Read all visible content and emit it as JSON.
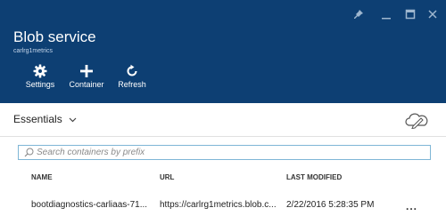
{
  "blade": {
    "title": "Blob service",
    "subtitle": "carlrg1metrics"
  },
  "commands": [
    {
      "label": "Settings",
      "icon": "gear-icon"
    },
    {
      "label": "Container",
      "icon": "plus-icon"
    },
    {
      "label": "Refresh",
      "icon": "refresh-icon"
    }
  ],
  "window_controls": [
    "pin-icon",
    "minimize-icon",
    "maximize-icon",
    "close-icon"
  ],
  "essentials": {
    "label": "Essentials",
    "icon": "chevron-down-icon"
  },
  "search": {
    "placeholder": "Search containers by prefix",
    "value": ""
  },
  "table": {
    "columns": [
      "NAME",
      "URL",
      "LAST MODIFIED"
    ],
    "rows": [
      {
        "name": "bootdiagnostics-carliaas-71...",
        "url": "https://carlrg1metrics.blob.c...",
        "last_modified": "2/22/2016 5:28:35 PM",
        "more": "..."
      }
    ]
  },
  "colors": {
    "header_bg": "#0d3f73",
    "accent": "#7fb6d6"
  }
}
